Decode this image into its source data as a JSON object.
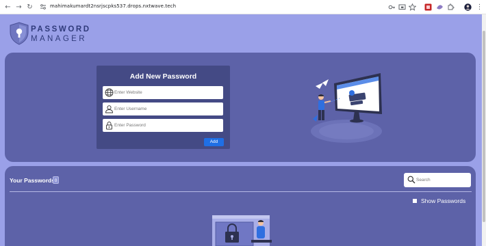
{
  "browser": {
    "url": "mahimakumardt2nsrjscpks537.drops.nxtwave.tech"
  },
  "logo": {
    "line1": "PASSWORD",
    "line2": "MANAGER"
  },
  "form": {
    "title": "Add New Password",
    "website_placeholder": "Enter Website",
    "username_placeholder": "Enter Username",
    "password_placeholder": "Enter Password",
    "add_label": "Add"
  },
  "passwords": {
    "title": "Your Passwords",
    "count": "0",
    "search_placeholder": "Search",
    "show_label": "Show Passwords"
  },
  "colors": {
    "page_bg": "#9aa0e8",
    "card_bg": "#5d62a8",
    "form_bg": "#444a85",
    "button": "#1f6fe5"
  }
}
